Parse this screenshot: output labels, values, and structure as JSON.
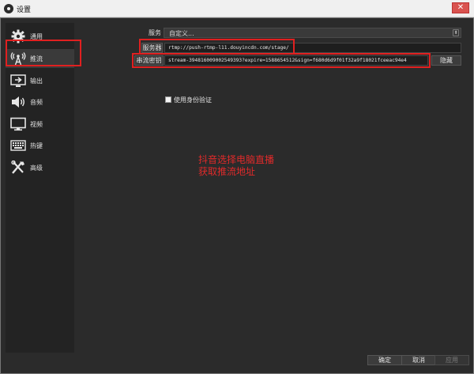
{
  "window": {
    "title": "设置",
    "close": "✕"
  },
  "sidebar": {
    "items": [
      {
        "label": "通用",
        "icon": "gear-icon"
      },
      {
        "label": "推流",
        "icon": "broadcast-icon"
      },
      {
        "label": "输出",
        "icon": "output-icon"
      },
      {
        "label": "音频",
        "icon": "speaker-icon"
      },
      {
        "label": "视频",
        "icon": "monitor-icon"
      },
      {
        "label": "热键",
        "icon": "keyboard-icon"
      },
      {
        "label": "高级",
        "icon": "tools-icon"
      }
    ],
    "active_index": 1
  },
  "stream": {
    "service_label": "服务",
    "service_value": "自定义...",
    "server_label": "服务器",
    "server_value": "rtmp://push-rtmp-l11.douyincdn.com/stage/",
    "key_label": "串流密钥",
    "key_value": "stream-394816009002549393?expire=1588654512&sign=f680d6d9f01f32a9f18021fceeac94e4",
    "hide_button": "隐藏",
    "auth_checkbox_label": "使用身份验证",
    "auth_checked": false
  },
  "annotation": {
    "line1": "抖音选择电脑直播",
    "line2": "获取推流地址",
    "color": "#e02a2a"
  },
  "buttons": {
    "ok": "确定",
    "cancel": "取消",
    "apply": "应用"
  },
  "colors": {
    "highlight_box": "#e02020",
    "background": "#2b2b2b",
    "sidebar": "#232323"
  }
}
